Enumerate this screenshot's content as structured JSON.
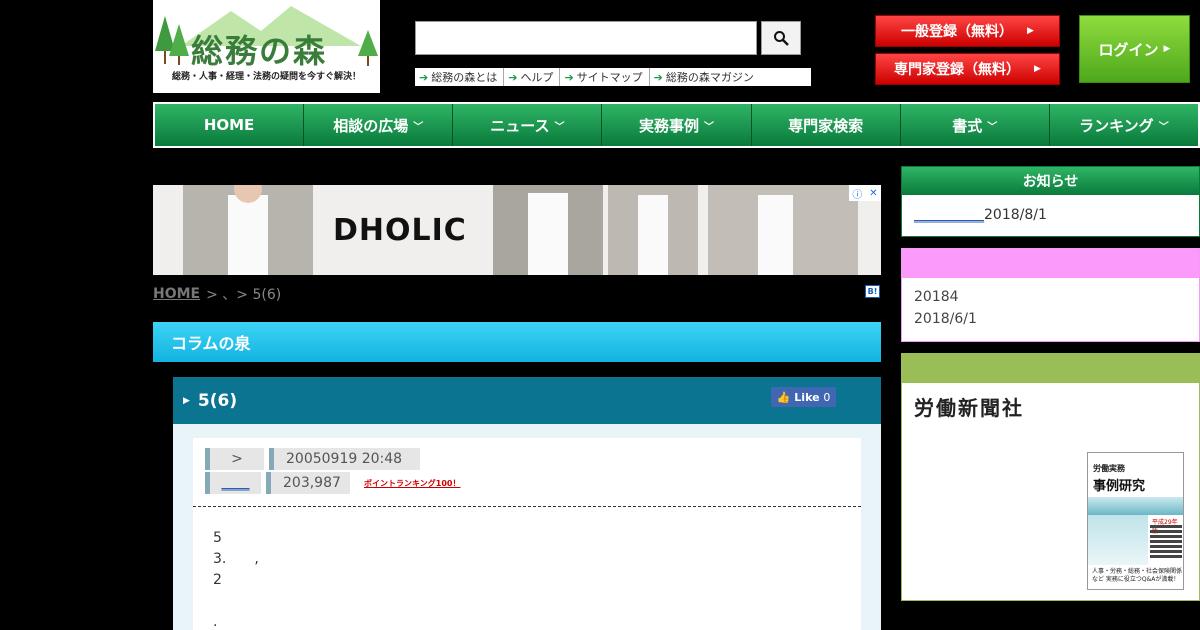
{
  "header": {
    "logo_title": "総務の森",
    "logo_tagline": "総務・人事・経理・法務の疑問を今すぐ解決！",
    "search_placeholder": "",
    "sublinks": [
      "総務の森とは",
      "ヘルプ",
      "サイトマップ",
      "総務の森マガジン"
    ],
    "register_general": "一般登録（無料）",
    "register_expert": "専門家登録（無料）",
    "login": "ログイン"
  },
  "nav": {
    "items": [
      {
        "label": "HOME",
        "dropdown": false
      },
      {
        "label": "相談の広場",
        "dropdown": true
      },
      {
        "label": "ニュース",
        "dropdown": true
      },
      {
        "label": "実務事例",
        "dropdown": true
      },
      {
        "label": "専門家検索",
        "dropdown": false
      },
      {
        "label": "書式",
        "dropdown": true
      },
      {
        "label": "ランキング",
        "dropdown": true
      }
    ]
  },
  "ad": {
    "brand": "DHOLIC"
  },
  "breadcrumb": {
    "home": "HOME",
    "rest": "> 、> 5(6)"
  },
  "bookmark": "B!",
  "column": {
    "title": "コラムの泉"
  },
  "article": {
    "title": "5(6)",
    "like_label": "Like",
    "like_count": "0",
    "meta": {
      "row1_label": ">",
      "row1_value": "20050919 20:48",
      "row2_label": "____",
      "row2_value": "203,987",
      "rank_link": "ポイントランキング100！"
    },
    "body_lines": [
      "5",
      "3.　　,",
      "2",
      "",
      "."
    ]
  },
  "sidebar": {
    "notice_title": "お知らせ",
    "notice_link": "__________",
    "notice_date": "2018/8/1",
    "pink_lines": [
      "20184",
      "2018/6/1"
    ],
    "publisher": "労働新聞社",
    "book": {
      "top": "労働実務",
      "title": "事例研究",
      "year": "平成29年版",
      "blurb": "人事・労務・総務・社会保険関係など 実務に役立つQ&Aが満載！"
    }
  },
  "colors": {
    "nav_green": "#0a7a3c",
    "column_cyan": "#12b3e0",
    "article_teal": "#0b7490",
    "register_red": "#c00",
    "login_green": "#4ea81c",
    "pink": "#fc9afc",
    "olive": "#9bbd57"
  }
}
